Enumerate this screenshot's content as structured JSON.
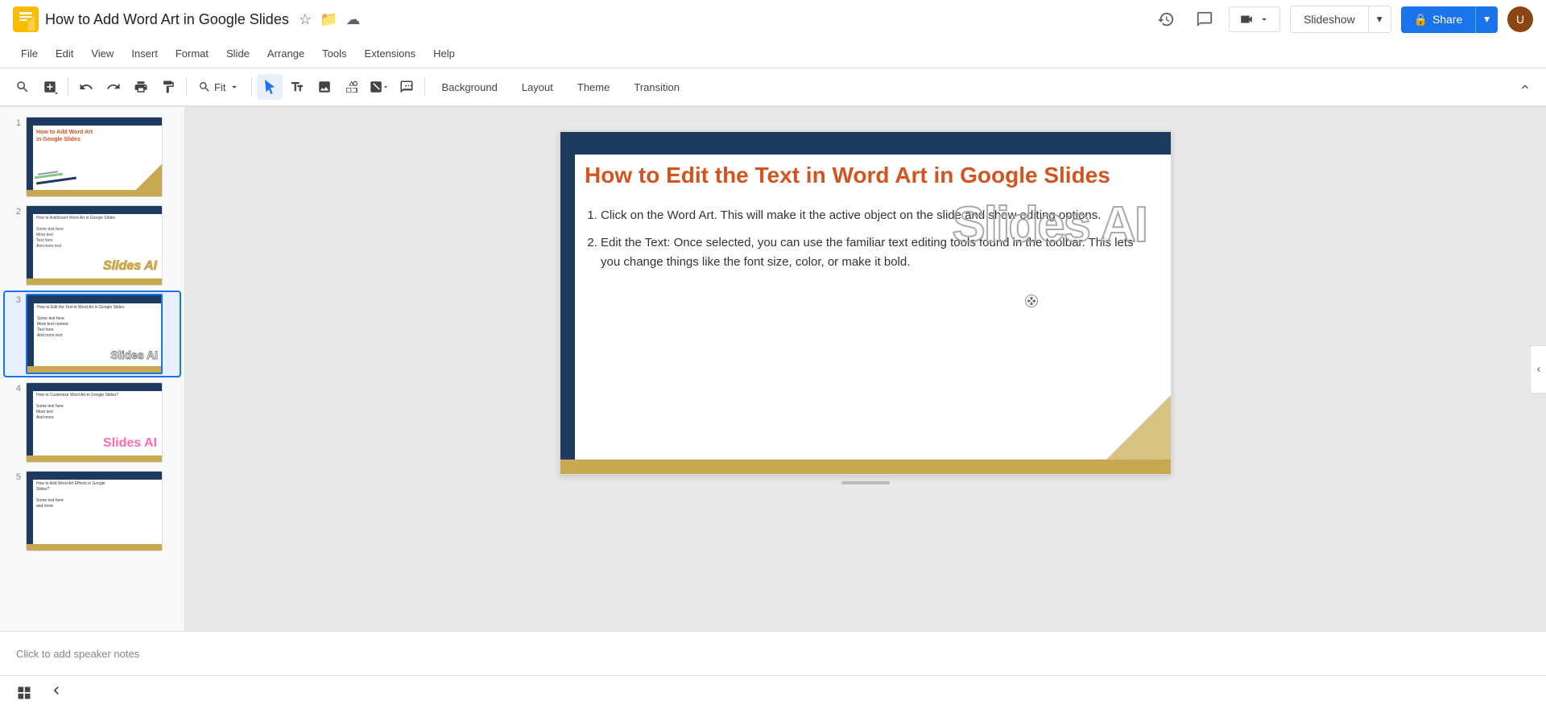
{
  "app": {
    "icon_color": "#fbbc04",
    "title": "How to Add Word Art in Google Slides",
    "title_star_icon": "★",
    "title_folder_icon": "📁",
    "title_cloud_icon": "☁"
  },
  "header": {
    "history_icon": "↩",
    "comments_icon": "💬",
    "meet_icon": "📹",
    "slideshow_label": "Slideshow",
    "slideshow_dropdown_icon": "▾",
    "share_label": "Share",
    "share_dropdown_icon": "▾",
    "share_lock_icon": "🔒"
  },
  "menu": {
    "items": [
      "File",
      "Edit",
      "View",
      "Insert",
      "Format",
      "Slide",
      "Arrange",
      "Tools",
      "Extensions",
      "Help"
    ]
  },
  "toolbar": {
    "search_icon": "🔍",
    "add_icon": "+",
    "undo_icon": "↩",
    "redo_icon": "↪",
    "print_icon": "🖨",
    "paint_format_icon": "🎨",
    "zoom_icon": "🔍",
    "zoom_label": "Fit",
    "zoom_dropdown_icon": "▾",
    "cursor_icon": "↖",
    "text_icon": "T",
    "image_icon": "🖼",
    "shapes_icon": "⬟",
    "lines_icon": "/",
    "extra_icon": "+",
    "background_label": "Background",
    "layout_label": "Layout",
    "theme_label": "Theme",
    "transition_label": "Transition",
    "collapse_icon": "⌃"
  },
  "slide_panel": {
    "slides": [
      {
        "number": "1",
        "title": "How to Add Word Art in Google Slides",
        "active": false
      },
      {
        "number": "2",
        "title": "How to Add/Insert Word Art in Google Slides",
        "active": false
      },
      {
        "number": "3",
        "title": "How to Edit the Text in Word Art in Google Slides",
        "active": true
      },
      {
        "number": "4",
        "title": "How to Customize Word Art in Google Slides?",
        "active": false
      },
      {
        "number": "5",
        "title": "How to Add Word Art Effects in Google Slides?",
        "active": false
      }
    ]
  },
  "slide": {
    "title": "How to Edit the Text in Word Art in Google Slides",
    "body_items": [
      "Click on the Word Art. This will make it the active object on the slide and show editing options.",
      "Edit the Text: Once selected, you can use the familiar text editing tools found in the toolbar. This lets you change things like the font size, color, or make it bold."
    ],
    "word_art_text": "Slides AI",
    "progress_indicator": ""
  },
  "speaker_notes": {
    "placeholder": "Click to add speaker notes"
  },
  "bottom_bar": {
    "grid_icon": "⊞",
    "panel_toggle_icon": "‹"
  }
}
